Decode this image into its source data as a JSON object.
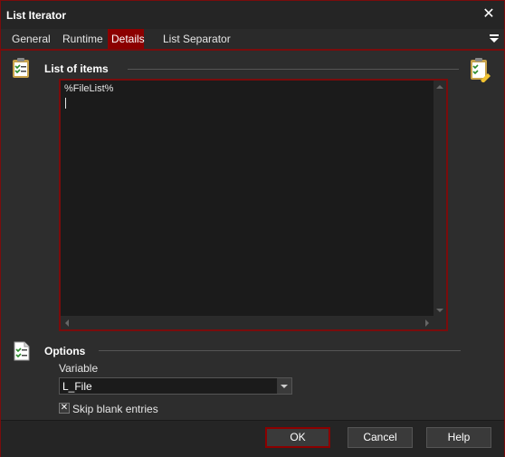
{
  "window": {
    "title": "List Iterator"
  },
  "tabs": [
    {
      "label": "General"
    },
    {
      "label": "Runtime"
    },
    {
      "label": "Details",
      "active": true
    },
    {
      "label": "List Separator"
    }
  ],
  "list_section": {
    "title": "List of items",
    "text": "%FileList%"
  },
  "options_section": {
    "title": "Options",
    "variable_label": "Variable",
    "variable_value": "L_File",
    "skip_blank_label": "Skip blank entries",
    "skip_blank_checked": true
  },
  "buttons": {
    "ok": "OK",
    "cancel": "Cancel",
    "help": "Help"
  },
  "colors": {
    "accent": "#8b0000",
    "background": "#2d2d2d",
    "field": "#1b1b1b"
  },
  "icons": [
    "close-icon",
    "tab-menu-icon",
    "clipboard-checklist-icon",
    "clipboard-edit-icon",
    "document-checklist-icon",
    "chevron-down-icon"
  ]
}
